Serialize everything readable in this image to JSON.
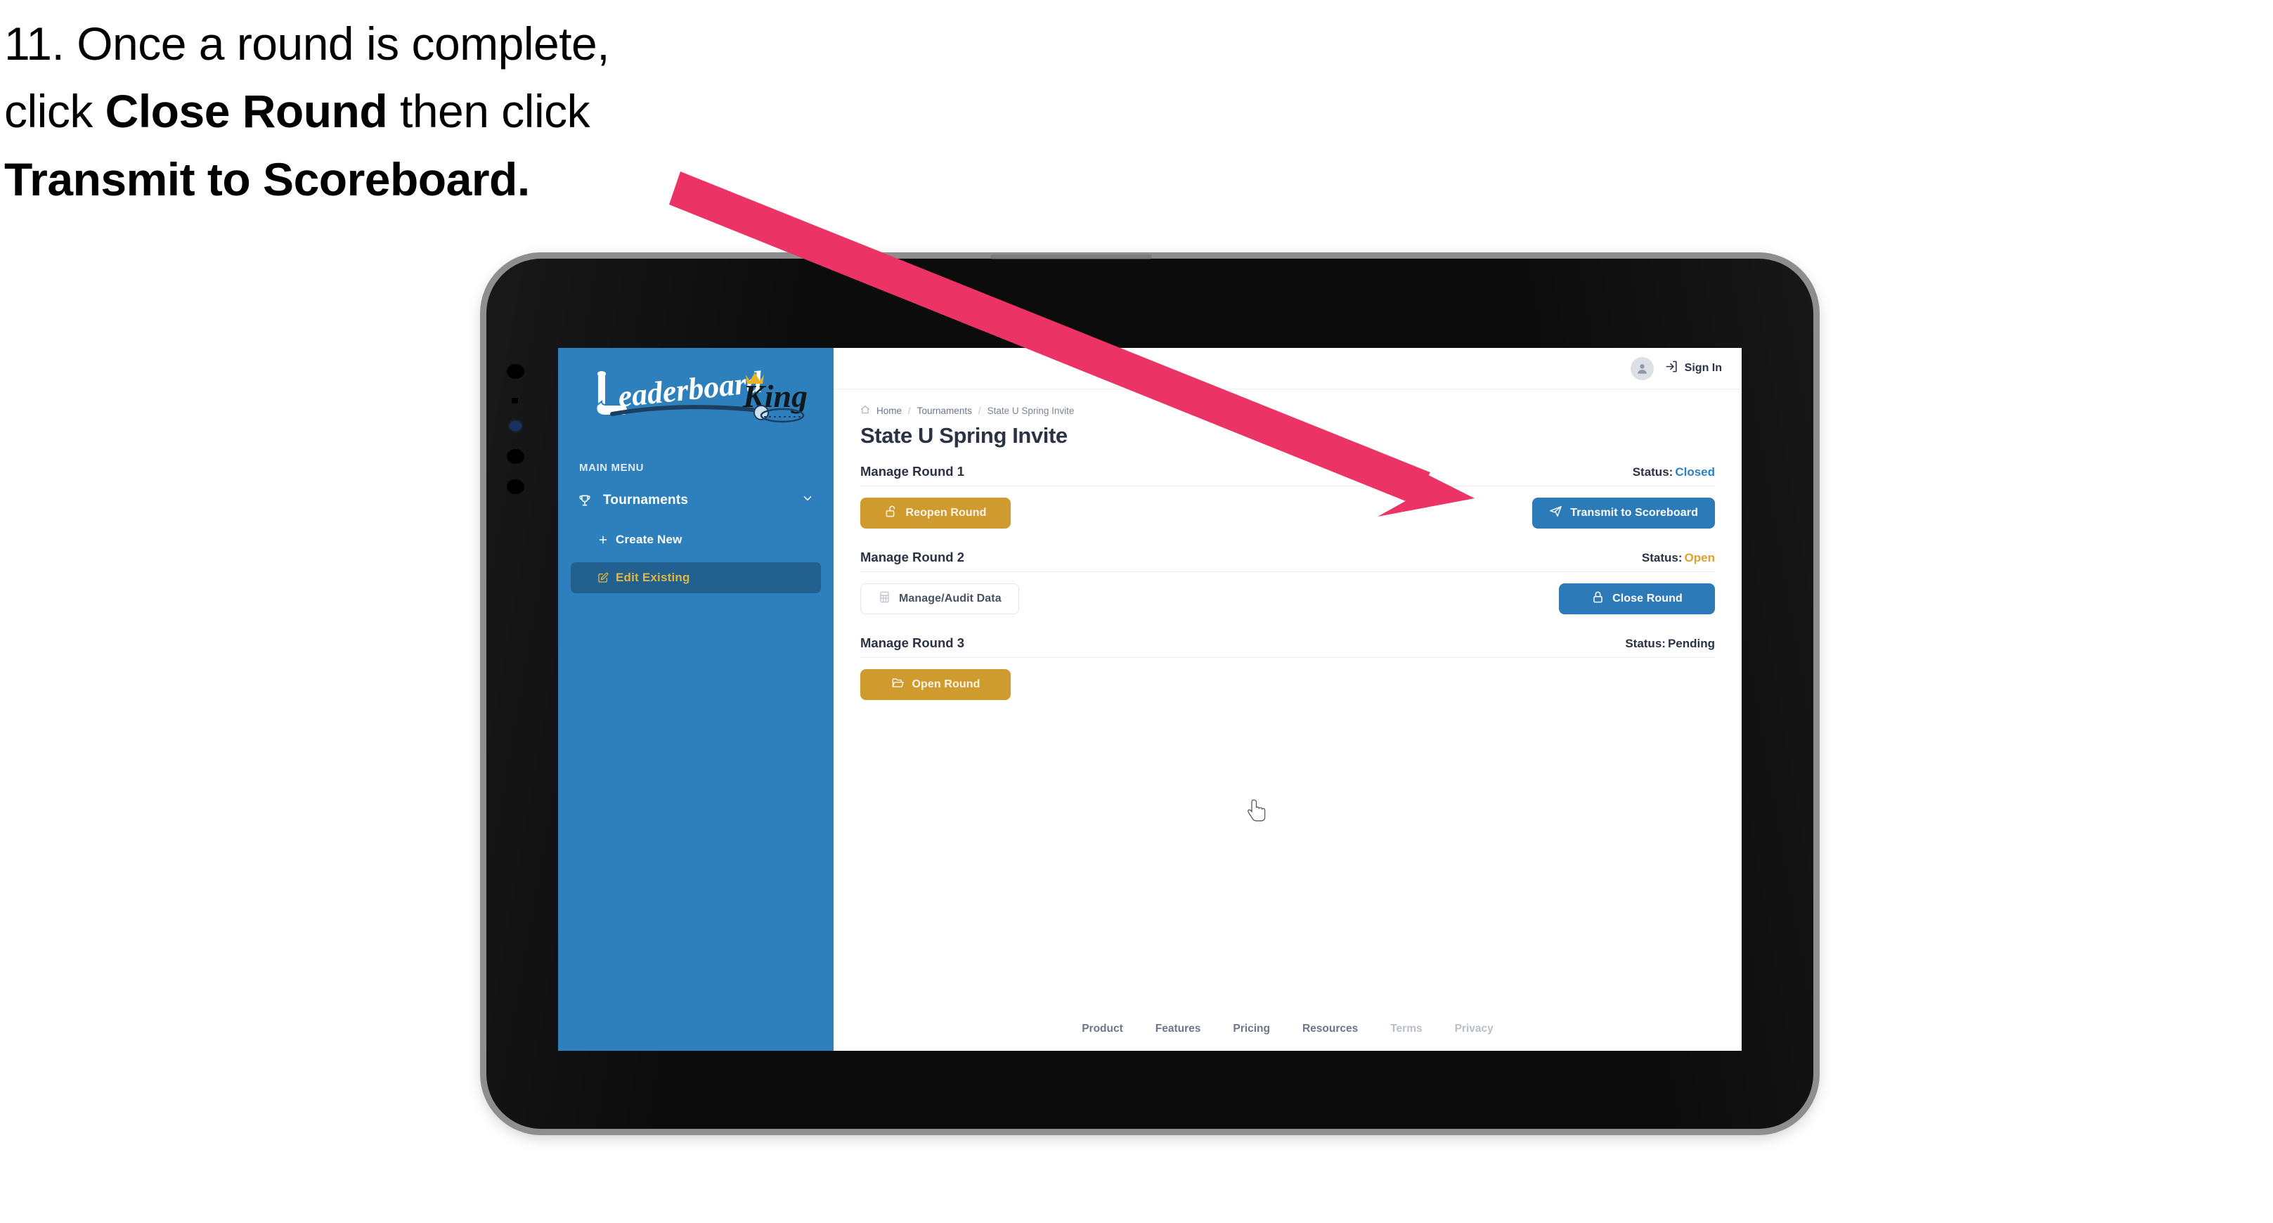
{
  "annotation": {
    "step_number": "11.",
    "line1": "11. Once a round is complete,",
    "line2_pre": "click ",
    "line2_bold": "Close Round",
    "line2_post": " then click",
    "line3_bold": "Transmit to Scoreboard.",
    "arrow_color": "#ec3366"
  },
  "sidebar": {
    "brand": "LeaderboardKing",
    "brand_part1": "eaderboard",
    "brand_part2": "King",
    "menu_label": "MAIN MENU",
    "background_color": "#2e80bd",
    "active_color": "#e3b63f",
    "items": [
      {
        "label": "Tournaments",
        "icon": "trophy-icon",
        "expanded": true,
        "chevron": "chevron-down-icon"
      },
      {
        "label": "Create New",
        "icon": "plus-icon",
        "active": false
      },
      {
        "label": "Edit Existing",
        "icon": "edit-pencil-icon",
        "active": true
      }
    ]
  },
  "topbar": {
    "avatar_icon": "user-avatar-icon",
    "signin_icon": "sign-in-icon",
    "signin_label": "Sign In"
  },
  "breadcrumb": {
    "home_icon": "home-icon",
    "items": [
      "Home",
      "Tournaments",
      "State U Spring Invite"
    ],
    "separator": "/"
  },
  "page": {
    "title": "State U Spring Invite"
  },
  "rounds": [
    {
      "title": "Manage Round 1",
      "status_label": "Status:",
      "status_value": "Closed",
      "status_color": "#2e80bd",
      "left_button": {
        "label": "Reopen Round",
        "icon": "unlock-icon",
        "style": "gold"
      },
      "right_button": {
        "label": "Transmit to Scoreboard",
        "icon": "send-plane-icon",
        "style": "blue"
      }
    },
    {
      "title": "Manage Round 2",
      "status_label": "Status:",
      "status_value": "Open",
      "status_color": "#e0a12c",
      "left_button": {
        "label": "Manage/Audit Data",
        "icon": "table-grid-icon",
        "style": "outline"
      },
      "right_button": {
        "label": "Close Round",
        "icon": "lock-icon",
        "style": "blue"
      }
    },
    {
      "title": "Manage Round 3",
      "status_label": "Status:",
      "status_value": "Pending",
      "status_color": "#2b3243",
      "left_button": {
        "label": "Open Round",
        "icon": "open-folder-icon",
        "style": "gold"
      },
      "right_button": null
    }
  ],
  "footer": {
    "links": [
      {
        "label": "Product",
        "muted": false
      },
      {
        "label": "Features",
        "muted": false
      },
      {
        "label": "Pricing",
        "muted": false
      },
      {
        "label": "Resources",
        "muted": false
      },
      {
        "label": "Terms",
        "muted": true
      },
      {
        "label": "Privacy",
        "muted": true
      }
    ]
  },
  "cursor": {
    "icon": "pointing-hand-cursor"
  },
  "colors": {
    "brand_blue": "#2e80bd",
    "button_blue": "#2d7ab8",
    "gold": "#cf9a2e",
    "sidebar_active": "#22618f",
    "text_dark": "#2b3243",
    "arrow_pink": "#ec3366"
  }
}
